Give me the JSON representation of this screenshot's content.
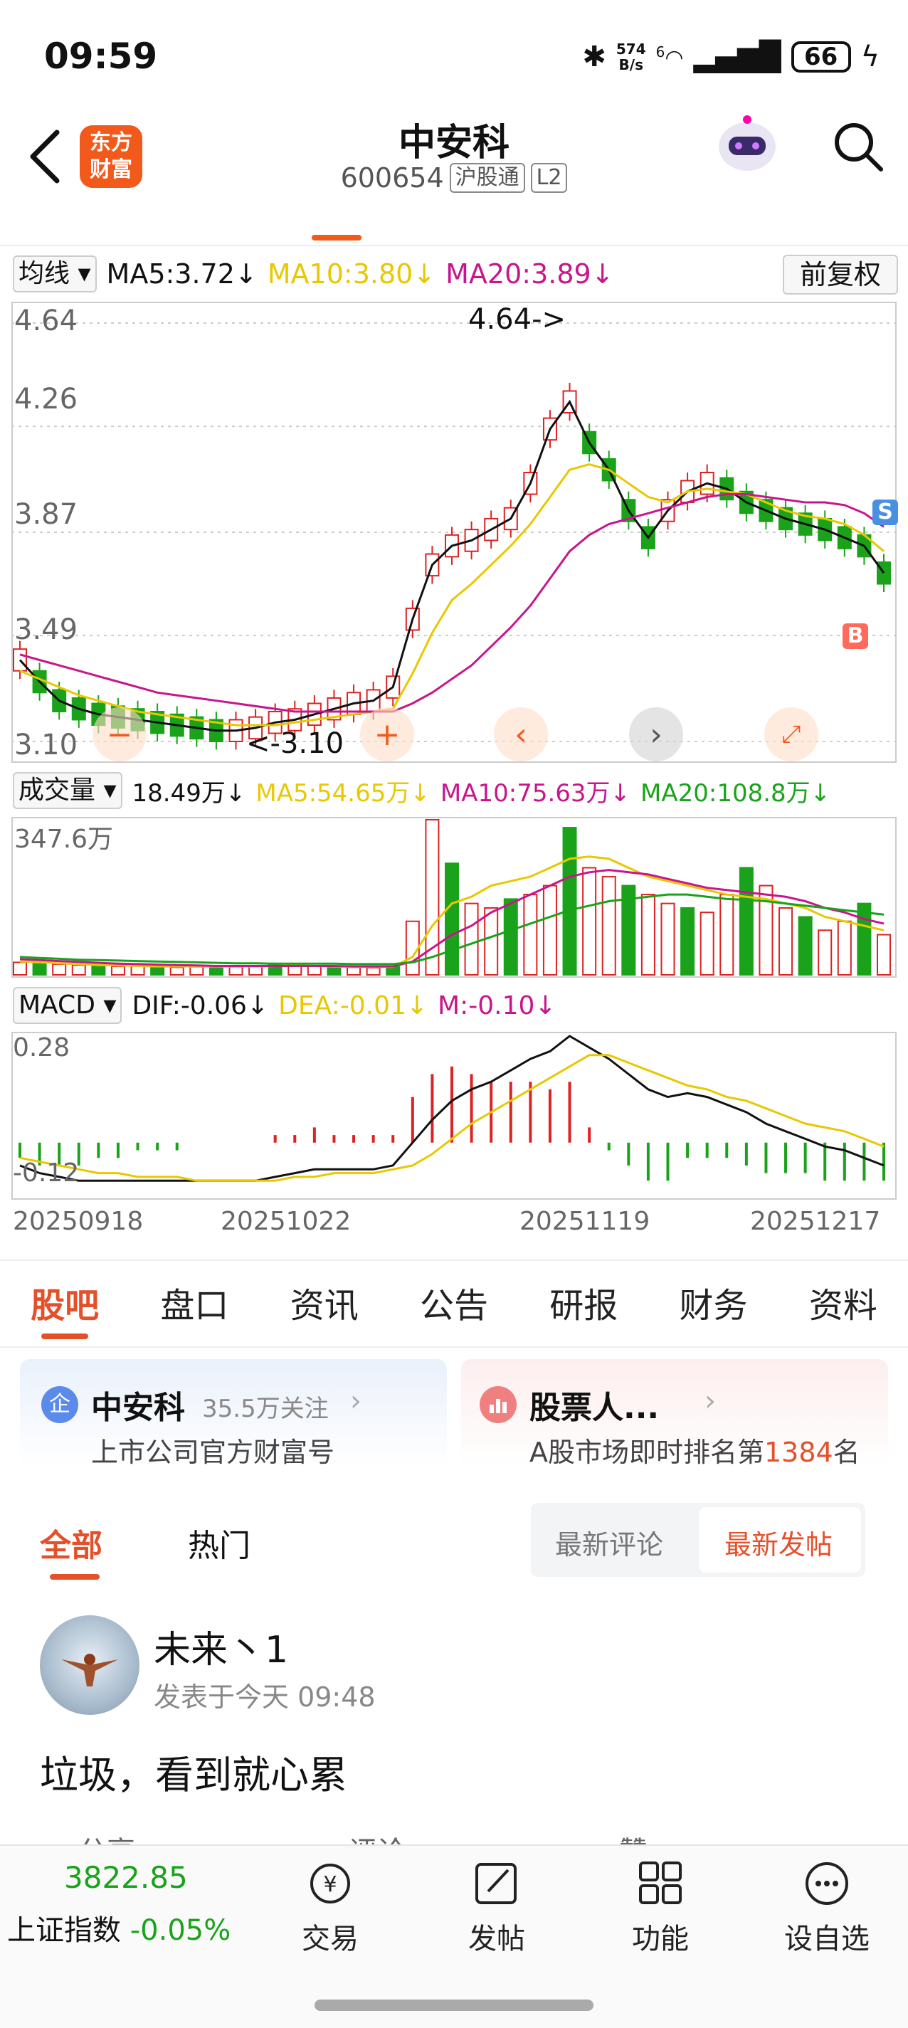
{
  "status_bar": {
    "time": "09:59",
    "net_speed_value": "574",
    "net_speed_unit": "B/s",
    "signal_label": "6",
    "battery": "66"
  },
  "header": {
    "logo_line1": "东方",
    "logo_line2": "财富",
    "stock_name": "中安科",
    "stock_code": "600654",
    "tag_connect": "沪股通",
    "tag_level": "L2"
  },
  "kline": {
    "selector": "均线",
    "ma5": "MA5:3.72↓",
    "ma10": "MA10:3.80↓",
    "ma20": "MA20:3.89↓",
    "adjust": "前复权",
    "y_ticks": [
      "4.64",
      "4.26",
      "3.87",
      "3.49",
      "3.10"
    ],
    "high_marker": "4.64->",
    "low_marker": "<-3.10",
    "sell_badge": "S",
    "buy_badge": "B"
  },
  "volume": {
    "selector": "成交量",
    "current": "18.49万↓",
    "ma5": "MA5:54.65万↓",
    "ma10": "MA10:75.63万↓",
    "ma20": "MA20:108.8万↓",
    "y_max": "347.6万"
  },
  "macd": {
    "selector": "MACD",
    "dif": "DIF:-0.06↓",
    "dea": "DEA:-0.01↓",
    "m": "M:-0.10↓",
    "y_top": "0.28",
    "y_bottom": "-0.12",
    "dates": [
      "20250918",
      "20251022",
      "20251119",
      "20251217"
    ]
  },
  "tabs": [
    "股吧",
    "盘口",
    "资讯",
    "公告",
    "研报",
    "财务",
    "资料"
  ],
  "cards": {
    "left_icon": "企",
    "left_title": "中安科",
    "left_followers": "35.5万关注",
    "left_sub": "上市公司官方财富号",
    "right_title": "股票人...",
    "right_sub_prefix": "A股市场即时排名第",
    "right_rank": "1384",
    "right_sub_suffix": "名"
  },
  "feed": {
    "tab_all": "全部",
    "tab_hot": "热门",
    "filter_latest_comment": "最新评论",
    "filter_latest_post": "最新发帖"
  },
  "post": {
    "author": "未来丶1",
    "time": "发表于今天 09:48",
    "content": "垃圾，看到就心累",
    "share": "分享",
    "comment": "评论",
    "like": "赞"
  },
  "bottom_bar": {
    "index_value": "3822.85",
    "index_name": "上证指数",
    "index_change": "-0.05%",
    "trade": "交易",
    "post": "发帖",
    "features": "功能",
    "watchlist": "设自选"
  },
  "colors": {
    "accent": "#e4502a",
    "up": "#d22",
    "down": "#1aa31a",
    "ma5": "#111111",
    "ma10": "#e8c800",
    "ma20": "#c8158c"
  },
  "chart_data": [
    {
      "type": "candlestick",
      "title": "",
      "ylim": [
        3.1,
        4.64
      ],
      "y_ticks": [
        4.64,
        4.26,
        3.87,
        3.49,
        3.1
      ],
      "grid": true,
      "series": [
        {
          "name": "MA5",
          "values": [
            3.4,
            3.32,
            3.25,
            3.22,
            3.2,
            3.19,
            3.18,
            3.17,
            3.16,
            3.15,
            3.14,
            3.14,
            3.15,
            3.17,
            3.18,
            3.2,
            3.22,
            3.24,
            3.25,
            3.3,
            3.55,
            3.75,
            3.82,
            3.84,
            3.88,
            3.92,
            4.05,
            4.25,
            4.35,
            4.2,
            4.1,
            3.95,
            3.85,
            3.95,
            4.02,
            4.05,
            4.03,
            3.98,
            3.95,
            3.92,
            3.9,
            3.88,
            3.85,
            3.82,
            3.72
          ]
        },
        {
          "name": "MA10",
          "values": [
            3.36,
            3.33,
            3.3,
            3.27,
            3.25,
            3.23,
            3.21,
            3.2,
            3.19,
            3.18,
            3.17,
            3.16,
            3.16,
            3.16,
            3.17,
            3.18,
            3.19,
            3.2,
            3.21,
            3.22,
            3.35,
            3.5,
            3.62,
            3.68,
            3.75,
            3.82,
            3.9,
            4.0,
            4.1,
            4.12,
            4.1,
            4.05,
            4.0,
            3.98,
            4.02,
            4.03,
            4.02,
            4.01,
            3.98,
            3.95,
            3.93,
            3.92,
            3.9,
            3.86,
            3.8
          ]
        },
        {
          "name": "MA20",
          "values": [
            3.42,
            3.4,
            3.38,
            3.36,
            3.34,
            3.32,
            3.3,
            3.28,
            3.27,
            3.26,
            3.25,
            3.24,
            3.23,
            3.22,
            3.21,
            3.21,
            3.21,
            3.21,
            3.21,
            3.21,
            3.24,
            3.28,
            3.33,
            3.38,
            3.45,
            3.52,
            3.6,
            3.7,
            3.8,
            3.86,
            3.9,
            3.92,
            3.94,
            3.96,
            3.98,
            4.0,
            4.01,
            4.01,
            4.0,
            3.99,
            3.98,
            3.98,
            3.97,
            3.94,
            3.89
          ]
        }
      ]
    },
    {
      "type": "bar",
      "title": "",
      "ylim": [
        0,
        347.6
      ],
      "values": [
        28,
        25,
        24,
        22,
        20,
        19,
        20,
        18,
        17,
        18,
        19,
        18,
        20,
        22,
        24,
        20,
        18,
        17,
        16,
        18,
        120,
        347.6,
        250,
        160,
        150,
        170,
        180,
        200,
        330,
        240,
        220,
        200,
        180,
        160,
        150,
        140,
        180,
        240,
        200,
        150,
        130,
        100,
        120,
        160,
        90
      ],
      "series": [
        {
          "name": "MA5",
          "values": [
            30,
            28,
            26,
            24,
            22,
            21,
            20,
            19,
            19,
            19,
            19,
            19,
            19,
            20,
            21,
            20,
            19,
            18,
            18,
            18,
            40,
            110,
            160,
            175,
            200,
            210,
            220,
            240,
            260,
            265,
            260,
            240,
            220,
            210,
            200,
            190,
            180,
            175,
            170,
            160,
            150,
            130,
            120,
            110,
            100
          ]
        },
        {
          "name": "MA10",
          "values": [
            35,
            33,
            31,
            29,
            27,
            25,
            24,
            23,
            22,
            21,
            20,
            20,
            20,
            20,
            20,
            20,
            20,
            19,
            19,
            19,
            30,
            60,
            90,
            110,
            140,
            160,
            180,
            200,
            220,
            230,
            235,
            230,
            225,
            215,
            205,
            195,
            190,
            185,
            180,
            175,
            165,
            150,
            140,
            125,
            115
          ]
        },
        {
          "name": "MA20",
          "values": [
            40,
            38,
            36,
            34,
            33,
            32,
            31,
            30,
            29,
            28,
            27,
            26,
            26,
            25,
            25,
            25,
            25,
            24,
            24,
            24,
            28,
            40,
            55,
            70,
            85,
            100,
            115,
            130,
            145,
            155,
            165,
            170,
            175,
            180,
            180,
            175,
            170,
            168,
            165,
            160,
            155,
            150,
            145,
            140,
            135
          ]
        }
      ]
    },
    {
      "type": "line",
      "title": "",
      "x": [
        "20250918",
        "20251022",
        "20251119",
        "20251217"
      ],
      "ylim": [
        -0.12,
        0.28
      ],
      "series": [
        {
          "name": "DIF",
          "values": [
            -0.06,
            -0.08,
            -0.09,
            -0.1,
            -0.1,
            -0.1,
            -0.1,
            -0.1,
            -0.1,
            -0.1,
            -0.1,
            -0.1,
            -0.1,
            -0.09,
            -0.08,
            -0.07,
            -0.07,
            -0.07,
            -0.07,
            -0.06,
            0.0,
            0.06,
            0.11,
            0.14,
            0.16,
            0.19,
            0.22,
            0.24,
            0.28,
            0.25,
            0.22,
            0.18,
            0.14,
            0.12,
            0.13,
            0.12,
            0.1,
            0.08,
            0.05,
            0.03,
            0.01,
            -0.01,
            -0.02,
            -0.04,
            -0.06
          ]
        },
        {
          "name": "DEA",
          "values": [
            -0.04,
            -0.05,
            -0.06,
            -0.07,
            -0.08,
            -0.08,
            -0.09,
            -0.09,
            -0.09,
            -0.1,
            -0.1,
            -0.1,
            -0.1,
            -0.1,
            -0.09,
            -0.09,
            -0.08,
            -0.08,
            -0.08,
            -0.07,
            -0.06,
            -0.03,
            0.01,
            0.05,
            0.08,
            0.11,
            0.14,
            0.17,
            0.2,
            0.23,
            0.23,
            0.21,
            0.19,
            0.17,
            0.15,
            0.14,
            0.12,
            0.11,
            0.09,
            0.07,
            0.05,
            0.04,
            0.03,
            0.01,
            -0.01
          ]
        }
      ]
    }
  ]
}
